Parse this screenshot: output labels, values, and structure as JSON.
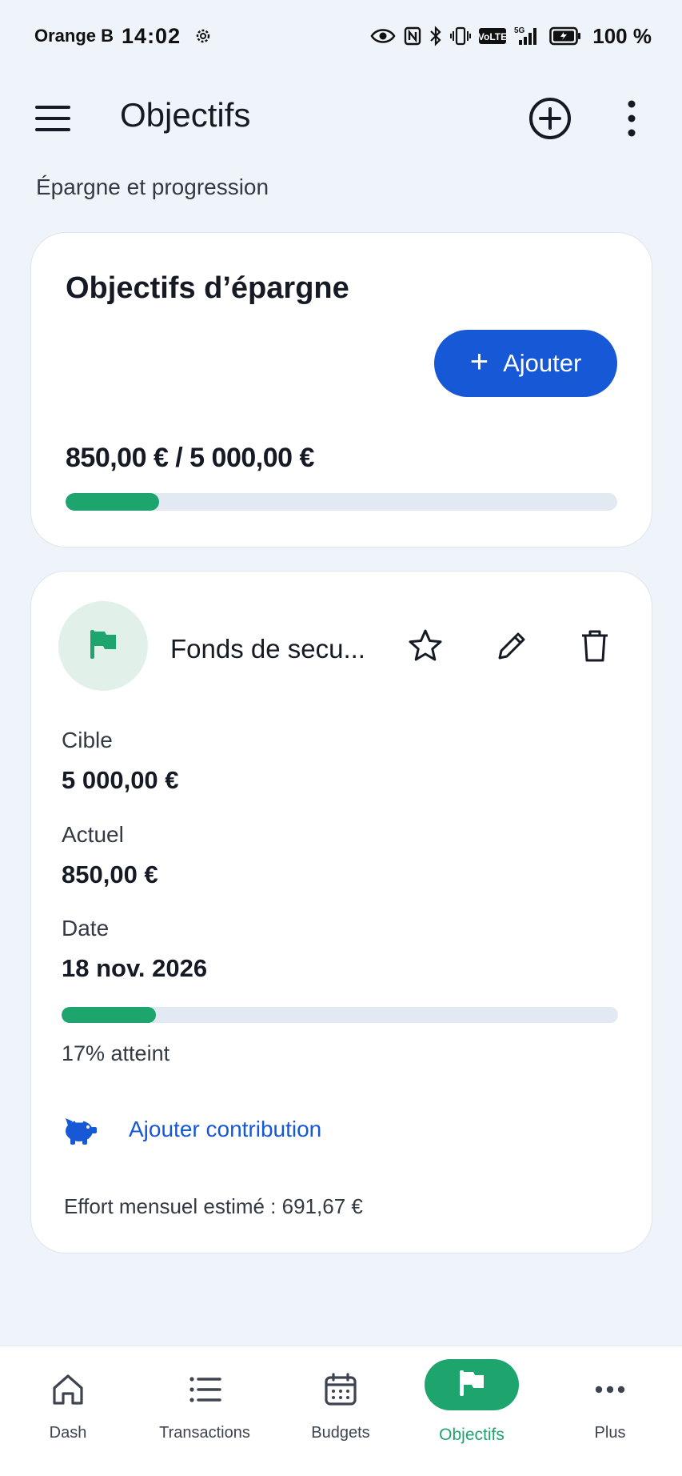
{
  "status_bar": {
    "carrier": "Orange B",
    "time": "14:02",
    "battery": "100 %",
    "icons": [
      "settings-gear-icon",
      "eye-icon",
      "nfc-icon",
      "bluetooth-icon",
      "vibrate-icon",
      "volte-icon",
      "signal-5g-icon",
      "battery-icon"
    ]
  },
  "app_bar": {
    "title": "Objectifs",
    "icons": [
      "menu-icon",
      "add-circle-icon",
      "more-vertical-icon"
    ]
  },
  "subtitle": "Épargne et progression",
  "savings_card": {
    "title": "Objectifs d’épargne",
    "add_button_label": "Ajouter",
    "amounts": "850,00 € / 5 000,00 €",
    "progress_fraction": 0.17,
    "progress_color": "#1ea56e"
  },
  "goal": {
    "name": "Fonds de secu...",
    "icon": "flag-icon",
    "target_label": "Cible",
    "target_value": "5 000,00 €",
    "current_label": "Actuel",
    "current_value": "850,00 €",
    "date_label": "Date",
    "date_value": "18 nov. 2026",
    "progress_fraction": 0.17,
    "progress_text": "17% atteint",
    "contribution_link": "Ajouter contribution",
    "effort_text": "Effort mensuel estimé : 691,67 €",
    "actions": [
      "star-icon",
      "edit-pencil-icon",
      "trash-icon"
    ]
  },
  "bottom_nav": {
    "items": [
      {
        "label": "Dash",
        "icon": "home-icon",
        "active": false
      },
      {
        "label": "Transactions",
        "icon": "list-icon",
        "active": false
      },
      {
        "label": "Budgets",
        "icon": "calendar-icon",
        "active": false
      },
      {
        "label": "Objectifs",
        "icon": "flag-icon",
        "active": true
      },
      {
        "label": "Plus",
        "icon": "more-horizontal-icon",
        "active": false
      }
    ]
  },
  "colors": {
    "accent_blue": "#1658d6",
    "accent_green": "#1ea56e",
    "background": "#eef4f9"
  }
}
